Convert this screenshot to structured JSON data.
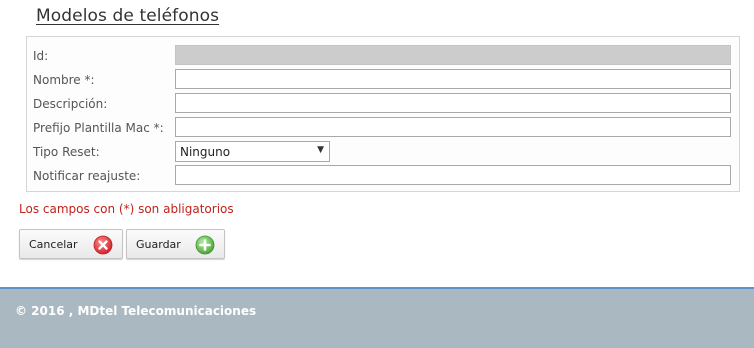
{
  "page": {
    "title": "Modelos de teléfonos"
  },
  "form": {
    "fields": [
      {
        "label": "Id:",
        "value": "",
        "disabled": true
      },
      {
        "label": "Nombre *:",
        "value": ""
      },
      {
        "label": "Descripción:",
        "value": ""
      },
      {
        "label": "Prefijo Plantilla Mac *:",
        "value": ""
      },
      {
        "label": "Tipo Reset:",
        "selected": "Ninguno"
      },
      {
        "label": "Notificar reajuste:",
        "value": ""
      }
    ],
    "required_note": "Los campos con (*) son abligatorios"
  },
  "buttons": {
    "cancel_label": "Cancelar",
    "cancel_icon": "close-circle-icon",
    "save_label": "Guardar",
    "save_icon": "plus-circle-icon"
  },
  "footer": {
    "text": "© 2016 , MDtel Telecomunicaciones"
  },
  "colors": {
    "required_note": "#c0221b",
    "footer_bg": "#aab8c1",
    "footer_border": "#5c93c9",
    "cancel_icon": "#e0353d",
    "save_icon": "#5fb84a",
    "disabled_field": "#cccccc"
  }
}
